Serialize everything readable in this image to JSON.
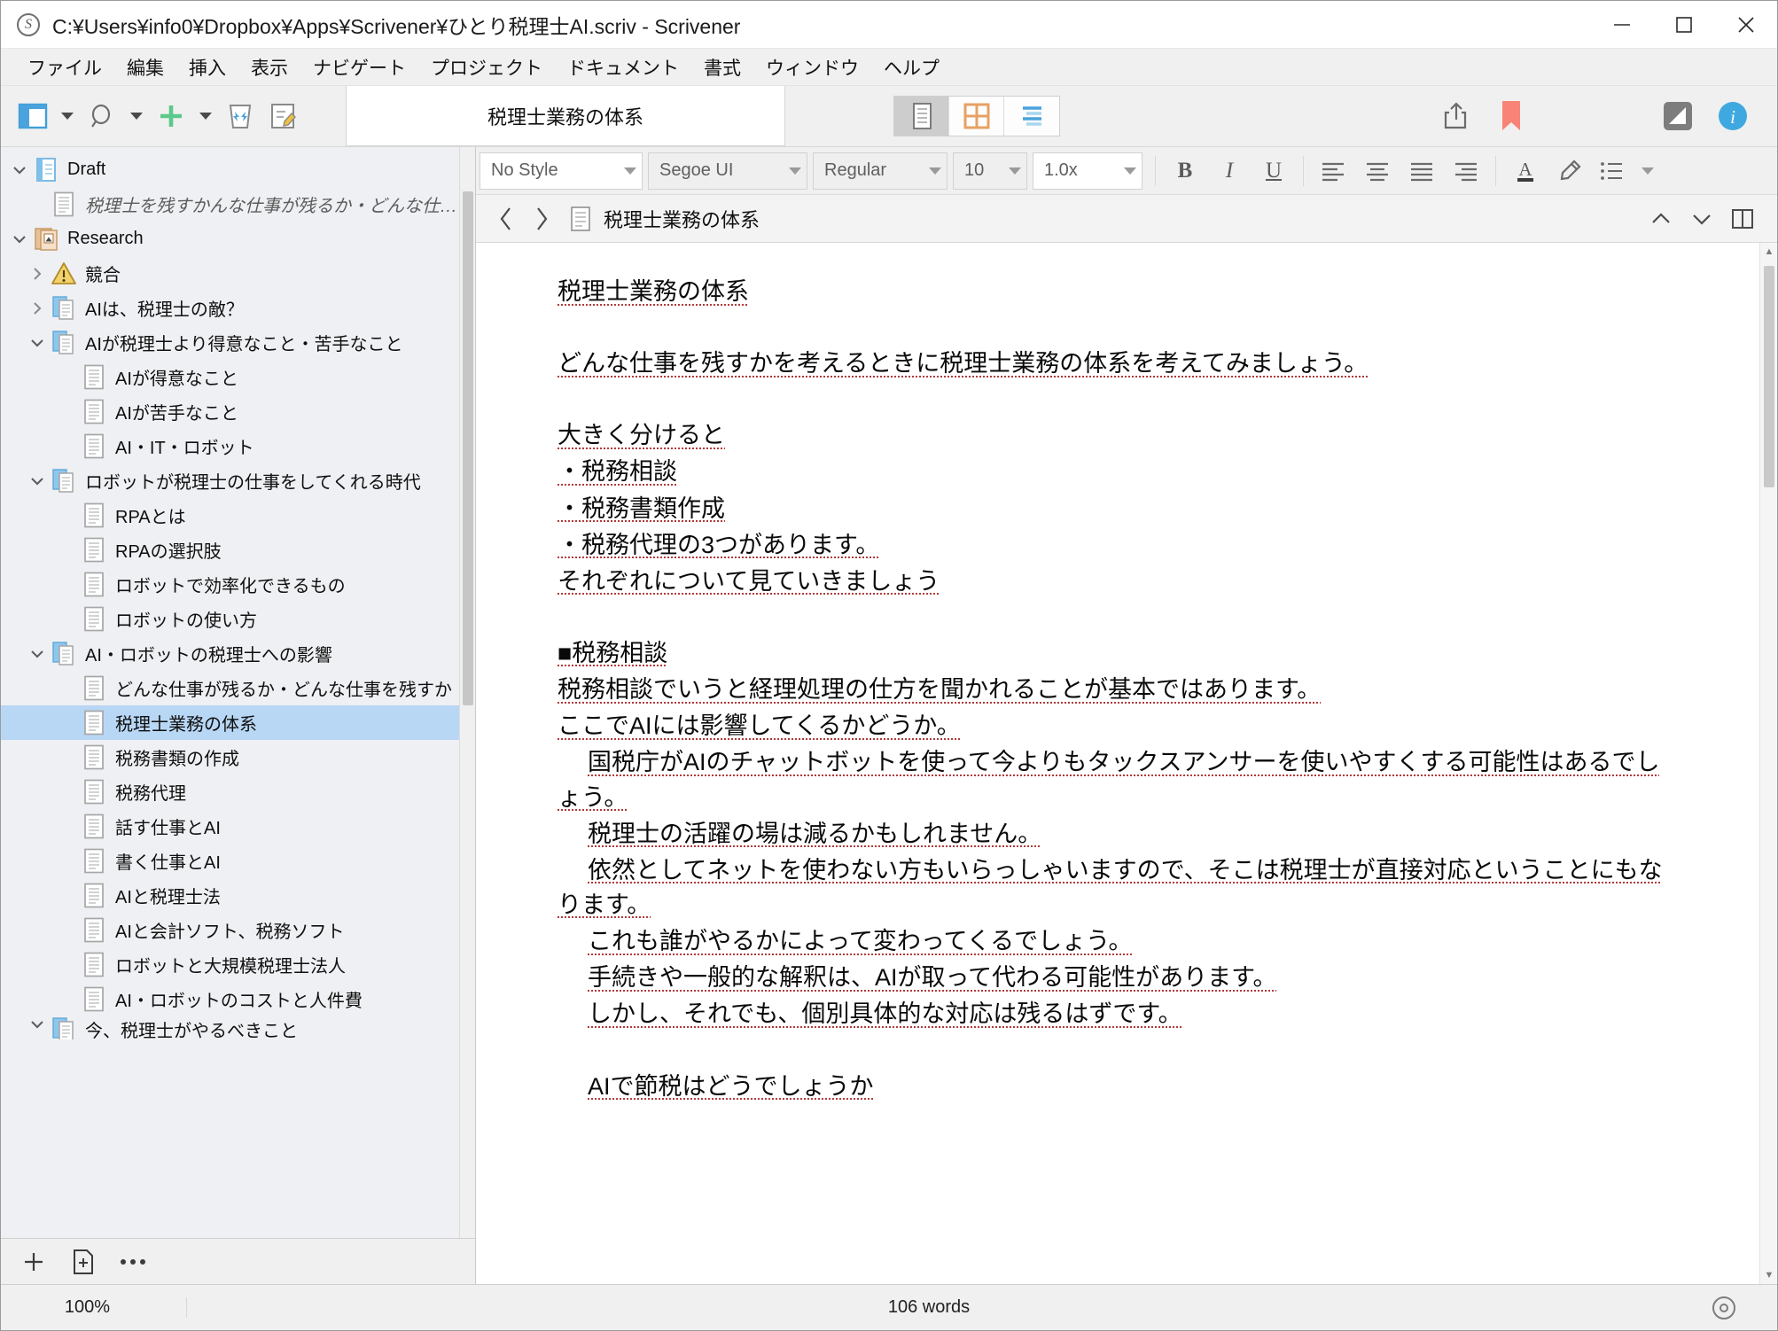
{
  "window": {
    "title": "C:¥Users¥info0¥Dropbox¥Apps¥Scrivener¥ひとり税理士AI.scriv - Scrivener",
    "app_badge": "S",
    "minimize_label": "最小化",
    "maximize_label": "最大化",
    "close_label": "閉じる"
  },
  "menubar": {
    "items": [
      "ファイル",
      "編集",
      "挿入",
      "表示",
      "ナビゲート",
      "プロジェクト",
      "ドキュメント",
      "書式",
      "ウィンドウ",
      "ヘルプ"
    ]
  },
  "toolbar": {
    "left_buttons": [
      {
        "name": "binder-toggle-icon",
        "label": "バインダー"
      },
      {
        "name": "search-icon",
        "label": "検索"
      },
      {
        "name": "add-icon",
        "label": "追加"
      },
      {
        "name": "trash-icon",
        "label": "ゴミ箱"
      },
      {
        "name": "compose-icon",
        "label": "コンポーズ"
      }
    ],
    "document_title": "税理士業務の体系",
    "view_modes": [
      {
        "name": "view-mode-document",
        "label": "ドキュメント",
        "active": true
      },
      {
        "name": "view-mode-corkboard",
        "label": "コルクボード",
        "active": false
      },
      {
        "name": "view-mode-outliner",
        "label": "アウトライナー",
        "active": false
      }
    ],
    "right_buttons": [
      {
        "name": "share-icon",
        "label": "共有"
      },
      {
        "name": "bookmark-icon",
        "label": "ブックマーク"
      },
      {
        "name": "composition-mode-icon",
        "label": "構成モード"
      },
      {
        "name": "inspector-info-icon",
        "label": "インスペクタ"
      }
    ]
  },
  "formatbar": {
    "style": "No Style",
    "font_family": "Segoe UI",
    "font_weight": "Regular",
    "font_size": "10",
    "line_spacing": "1.0x",
    "bold": "B",
    "italic": "I",
    "underline": "U",
    "align_left": "左揃え",
    "align_center": "中央揃え",
    "align_justify": "均等割付",
    "align_right": "右揃え",
    "text_color": "A",
    "highlight": "ハイライト",
    "list": "リスト"
  },
  "document_header": {
    "back_label": "戻る",
    "forward_label": "進む",
    "title": "税理士業務の体系",
    "prev_doc_label": "前のドキュメント",
    "next_doc_label": "次のドキュメント",
    "split_label": "分割"
  },
  "binder": {
    "items": [
      {
        "label": "Draft",
        "indent": 0,
        "twisty": "down",
        "icon": "draft-folder-icon",
        "selected": false,
        "italic": false
      },
      {
        "label": "税理士を残すかんな仕事が残るか・どんな仕事を残すか",
        "indent": 1,
        "twisty": "none",
        "icon": "text-doc-icon",
        "selected": false,
        "italic": true
      },
      {
        "label": "Research",
        "indent": 0,
        "twisty": "down",
        "icon": "research-folder-icon",
        "selected": false,
        "italic": false
      },
      {
        "label": "競合",
        "indent": 1,
        "twisty": "right",
        "icon": "warning-icon",
        "selected": false,
        "italic": false
      },
      {
        "label": "AIは、税理士の敵？",
        "indent": 1,
        "twisty": "right",
        "icon": "stack-doc-icon",
        "selected": false,
        "italic": false
      },
      {
        "label": "AIが税理士より得意なこと・苦手なこと",
        "indent": 1,
        "twisty": "down",
        "icon": "stack-doc-icon",
        "selected": false,
        "italic": false
      },
      {
        "label": "AIが得意なこと",
        "indent": 2,
        "twisty": "none",
        "icon": "text-doc-icon",
        "selected": false,
        "italic": false
      },
      {
        "label": "AIが苦手なこと",
        "indent": 2,
        "twisty": "none",
        "icon": "text-doc-icon",
        "selected": false,
        "italic": false
      },
      {
        "label": "AI・IT・ロボット",
        "indent": 2,
        "twisty": "none",
        "icon": "text-doc-icon",
        "selected": false,
        "italic": false
      },
      {
        "label": "ロボットが税理士の仕事をしてくれる時代",
        "indent": 1,
        "twisty": "down",
        "icon": "stack-doc-icon",
        "selected": false,
        "italic": false
      },
      {
        "label": "RPAとは",
        "indent": 2,
        "twisty": "none",
        "icon": "text-doc-icon",
        "selected": false,
        "italic": false
      },
      {
        "label": "RPAの選択肢",
        "indent": 2,
        "twisty": "none",
        "icon": "text-doc-icon",
        "selected": false,
        "italic": false
      },
      {
        "label": "ロボットで効率化できるもの",
        "indent": 2,
        "twisty": "none",
        "icon": "text-doc-icon",
        "selected": false,
        "italic": false
      },
      {
        "label": "ロボットの使い方",
        "indent": 2,
        "twisty": "none",
        "icon": "text-doc-icon",
        "selected": false,
        "italic": false
      },
      {
        "label": "AI・ロボットの税理士への影響",
        "indent": 1,
        "twisty": "down",
        "icon": "stack-doc-icon",
        "selected": false,
        "italic": false
      },
      {
        "label": "どんな仕事が残るか・どんな仕事を残すか",
        "indent": 2,
        "twisty": "none",
        "icon": "text-doc-icon",
        "selected": false,
        "italic": false
      },
      {
        "label": "税理士業務の体系",
        "indent": 2,
        "twisty": "none",
        "icon": "text-doc-icon",
        "selected": true,
        "italic": false
      },
      {
        "label": "税務書類の作成",
        "indent": 2,
        "twisty": "none",
        "icon": "text-doc-icon",
        "selected": false,
        "italic": false
      },
      {
        "label": "税務代理",
        "indent": 2,
        "twisty": "none",
        "icon": "text-doc-icon",
        "selected": false,
        "italic": false
      },
      {
        "label": "話す仕事とAI",
        "indent": 2,
        "twisty": "none",
        "icon": "text-doc-icon",
        "selected": false,
        "italic": false
      },
      {
        "label": "書く仕事とAI",
        "indent": 2,
        "twisty": "none",
        "icon": "text-doc-icon",
        "selected": false,
        "italic": false
      },
      {
        "label": "AIと税理士法",
        "indent": 2,
        "twisty": "none",
        "icon": "text-doc-icon",
        "selected": false,
        "italic": false
      },
      {
        "label": "AIと会計ソフト、税務ソフト",
        "indent": 2,
        "twisty": "none",
        "icon": "text-doc-icon",
        "selected": false,
        "italic": false
      },
      {
        "label": "ロボットと大規模税理士法人",
        "indent": 2,
        "twisty": "none",
        "icon": "text-doc-icon",
        "selected": false,
        "italic": false
      },
      {
        "label": "AI・ロボットのコストと人件費",
        "indent": 2,
        "twisty": "none",
        "icon": "text-doc-icon",
        "selected": false,
        "italic": false
      },
      {
        "label": "今、税理士がやるべきこと",
        "indent": 1,
        "twisty": "down",
        "icon": "stack-doc-icon",
        "selected": false,
        "italic": false
      }
    ],
    "footer": {
      "add_label": "追加",
      "add_doc_label": "新規ドキュメント",
      "more_label": "•••"
    }
  },
  "editor": {
    "paragraphs": [
      {
        "text": "税理士業務の体系",
        "indent": false,
        "blank": false
      },
      {
        "text": "",
        "indent": false,
        "blank": true
      },
      {
        "text": "どんな仕事を残すかを考えるときに税理士業務の体系を考えてみましょう。",
        "indent": false,
        "blank": false
      },
      {
        "text": "",
        "indent": false,
        "blank": true
      },
      {
        "text": "大きく分けると",
        "indent": false,
        "blank": false
      },
      {
        "text": "・税務相談",
        "indent": false,
        "blank": false
      },
      {
        "text": "・税務書類作成",
        "indent": false,
        "blank": false
      },
      {
        "text": "・税務代理の3つがあります。",
        "indent": false,
        "blank": false
      },
      {
        "text": "それぞれについて見ていきましょう",
        "indent": false,
        "blank": false
      },
      {
        "text": "",
        "indent": false,
        "blank": true
      },
      {
        "text": "■税務相談",
        "indent": false,
        "blank": false
      },
      {
        "text": "税務相談でいうと経理処理の仕方を聞かれることが基本ではあります。",
        "indent": false,
        "blank": false
      },
      {
        "text": "ここでAIには影響してくるかどうか。",
        "indent": false,
        "blank": false
      },
      {
        "text": "国税庁がAIのチャットボットを使って今よりもタックスアンサーを使いやすくする可能性はあるでしょう。",
        "indent": true,
        "blank": false
      },
      {
        "text": "税理士の活躍の場は減るかもしれません。",
        "indent": true,
        "blank": false
      },
      {
        "text": "依然としてネットを使わない方もいらっしゃいますので、そこは税理士が直接対応ということにもなります。",
        "indent": true,
        "blank": false
      },
      {
        "text": "これも誰がやるかによって変わってくるでしょう。",
        "indent": true,
        "blank": false
      },
      {
        "text": "手続きや一般的な解釈は、AIが取って代わる可能性があります。",
        "indent": true,
        "blank": false
      },
      {
        "text": "しかし、それでも、個別具体的な対応は残るはずです。",
        "indent": true,
        "blank": false
      },
      {
        "text": "",
        "indent": false,
        "blank": true
      },
      {
        "text": "AIで節税はどうでしょうか",
        "indent": true,
        "blank": false
      }
    ]
  },
  "statusbar": {
    "zoom": "100%",
    "word_count": "106 words",
    "target_label": "目標"
  },
  "colors": {
    "selection_blue": "#b8d7f5",
    "accent_blue": "#4aa3dc",
    "bookmark_red": "#f98377",
    "folder_blue": "#6ab3e6",
    "research_tan": "#e0b183",
    "spell_underline": "#b03a3a",
    "add_green": "#5cc98c"
  }
}
